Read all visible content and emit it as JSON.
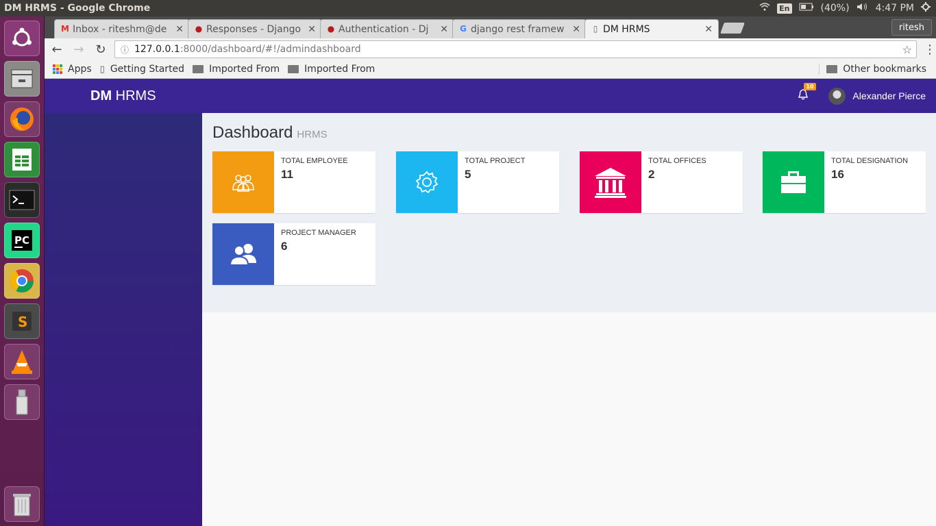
{
  "os": {
    "window_title": "DM HRMS - Google Chrome",
    "lang": "En",
    "battery": "(40%)",
    "time": "4:47 PM"
  },
  "browser": {
    "tabs": [
      {
        "label": "Inbox - riteshm@de",
        "icon": "gmail-icon"
      },
      {
        "label": "Responses - Django",
        "icon": "django-icon"
      },
      {
        "label": "Authentication - Dj",
        "icon": "django-icon"
      },
      {
        "label": "django rest framew",
        "icon": "google-icon"
      },
      {
        "label": "DM HRMS",
        "icon": "page-icon"
      }
    ],
    "profile": "ritesh",
    "url_host": "127.0.0.1",
    "url_path": ":8000/dashboard/#!/admindashboard",
    "bookmarks": [
      "Apps",
      "Getting Started",
      "Imported From",
      "Imported From"
    ],
    "other_bookmarks": "Other bookmarks"
  },
  "header": {
    "brand_bold": "DM",
    "brand_rest": " HRMS",
    "notification_count": "10",
    "user_name": "Alexander Pierce"
  },
  "dashboard": {
    "title": "Dashboard",
    "subtitle": "HRMS",
    "cards": [
      {
        "label": "TOTAL EMPLOYEE",
        "value": "11",
        "color": "#f39c12",
        "icon": "users-icon"
      },
      {
        "label": "TOTAL PROJECT",
        "value": "5",
        "color": "#1cb7f0",
        "icon": "gear-icon"
      },
      {
        "label": "TOTAL OFFICES",
        "value": "2",
        "color": "#e8005a",
        "icon": "bank-icon"
      },
      {
        "label": "TOTAL DESIGNATION",
        "value": "16",
        "color": "#00b85c",
        "icon": "briefcase-icon"
      },
      {
        "label": "PROJECT MANAGER",
        "value": "6",
        "color": "#3a5cc0",
        "icon": "user-group-icon"
      }
    ]
  }
}
